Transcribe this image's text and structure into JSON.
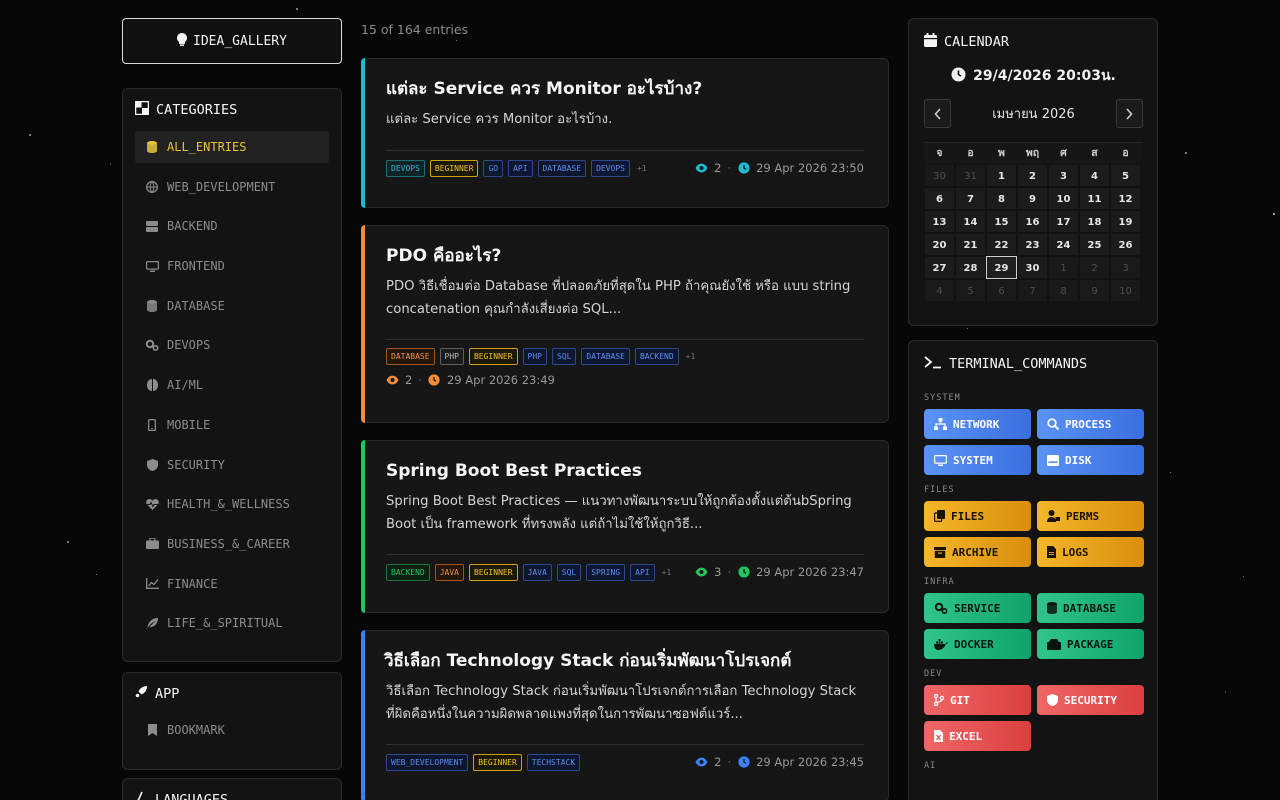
{
  "brand": {
    "label": "IDEA_GALLERY"
  },
  "categories": {
    "title": "CATEGORIES",
    "items": [
      {
        "label": "ALL_ENTRIES",
        "icon": "database-icon"
      },
      {
        "label": "WEB_DEVELOPMENT",
        "icon": "globe-icon"
      },
      {
        "label": "BACKEND",
        "icon": "server-icon"
      },
      {
        "label": "FRONTEND",
        "icon": "monitor-icon"
      },
      {
        "label": "DATABASE",
        "icon": "database-icon"
      },
      {
        "label": "DEVOPS",
        "icon": "gears-icon"
      },
      {
        "label": "AI/ML",
        "icon": "brain-icon"
      },
      {
        "label": "MOBILE",
        "icon": "mobile-icon"
      },
      {
        "label": "SECURITY",
        "icon": "shield-icon"
      },
      {
        "label": "HEALTH_&_WELLNESS",
        "icon": "heart-pulse-icon"
      },
      {
        "label": "BUSINESS_&_CAREER",
        "icon": "briefcase-icon"
      },
      {
        "label": "FINANCE",
        "icon": "chart-line-icon"
      },
      {
        "label": "LIFE_&_SPIRITUAL",
        "icon": "feather-icon"
      }
    ]
  },
  "app": {
    "title": "APP",
    "items": [
      {
        "label": "BOOKMARK"
      }
    ]
  },
  "languages": {
    "title": "LANGUAGES"
  },
  "feed": {
    "count_text": "15 of 164 entries",
    "cards": [
      {
        "title": "แต่ละ Service ควร Monitor อะไรบ้าง?",
        "excerpt": "แต่ละ Service ควร Monitor อะไรบ้าง.",
        "tags": [
          "DEVOPS",
          "BEGINNER",
          "GO",
          "API",
          "DATABASE",
          "DEVOPS"
        ],
        "more": "+1",
        "views": "2",
        "date": "29 Apr 2026 23:50",
        "accent": "#22b8cf"
      },
      {
        "title": "PDO คืออะไร?",
        "excerpt": "PDO วิธีเชื่อมต่อ Database ที่ปลอดภัยที่สุดใน PHP ถ้าคุณยังใช้ หรือ แบบ string concatenation คุณกำลังเสี่ยงต่อ SQL...",
        "tags": [
          "DATABASE",
          "PHP",
          "BEGINNER",
          "PHP",
          "SQL",
          "DATABASE",
          "BACKEND"
        ],
        "more": "+1",
        "views": "2",
        "date": "29 Apr 2026 23:49",
        "accent": "#f08c3a"
      },
      {
        "title": "Spring Boot Best Practices",
        "excerpt": "Spring Boot Best Practices — แนวทางพัฒนาระบบให้ถูกต้องตั้งแต่ต้นbSpring Boot เป็น framework ที่ทรงพลัง แต่ถ้าไม่ใช้ให้ถูกวิธี...",
        "tags": [
          "BACKEND",
          "JAVA",
          "BEGINNER",
          "JAVA",
          "SQL",
          "SPRING",
          "API"
        ],
        "more": "+1",
        "views": "3",
        "date": "29 Apr 2026 23:47",
        "accent": "#22c55e"
      },
      {
        "title": "วิธีเลือก Technology Stack ก่อนเริ่มพัฒนาโปรเจกต์",
        "excerpt": "วิธีเลือก Technology Stack ก่อนเริ่มพัฒนาโปรเจกต์การเลือก Technology Stack ที่ผิดคือหนึ่งในความผิดพลาดแพงที่สุดในการพัฒนาซอฟต์แวร์...",
        "tags": [
          "WEB_DEVELOPMENT",
          "BEGINNER",
          "TECHSTACK"
        ],
        "more": "",
        "views": "2",
        "date": "29 Apr 2026 23:45",
        "accent": "#3b82f6"
      }
    ]
  },
  "calendar": {
    "title": "CALENDAR",
    "now": "29/4/2026 20:03น.",
    "month_label": "เมษายน 2026",
    "weekdays": [
      "จ",
      "อ",
      "พ",
      "พฤ",
      "ศ",
      "ส",
      "อ"
    ],
    "days": [
      [
        "30",
        "31",
        "1",
        "2",
        "3",
        "4",
        "5"
      ],
      [
        "6",
        "7",
        "8",
        "9",
        "10",
        "11",
        "12"
      ],
      [
        "13",
        "14",
        "15",
        "16",
        "17",
        "18",
        "19"
      ],
      [
        "20",
        "21",
        "22",
        "23",
        "24",
        "25",
        "26"
      ],
      [
        "27",
        "28",
        "29",
        "30",
        "1",
        "2",
        "3"
      ],
      [
        "4",
        "5",
        "6",
        "7",
        "8",
        "9",
        "10"
      ]
    ],
    "today": "29"
  },
  "terminal": {
    "title": "TERMINAL_COMMANDS",
    "groups": [
      {
        "label": "SYSTEM",
        "color": "blue",
        "buttons": [
          {
            "label": "NETWORK",
            "icon": "network-icon"
          },
          {
            "label": "PROCESS",
            "icon": "search-icon"
          },
          {
            "label": "SYSTEM",
            "icon": "monitor-icon"
          },
          {
            "label": "DISK",
            "icon": "disk-icon"
          }
        ]
      },
      {
        "label": "FILES",
        "color": "amber",
        "buttons": [
          {
            "label": "FILES",
            "icon": "copy-icon"
          },
          {
            "label": "PERMS",
            "icon": "user-lock-icon"
          },
          {
            "label": "ARCHIVE",
            "icon": "archive-icon"
          },
          {
            "label": "LOGS",
            "icon": "file-icon"
          }
        ]
      },
      {
        "label": "INFRA",
        "color": "green",
        "buttons": [
          {
            "label": "SERVICE",
            "icon": "gears-icon"
          },
          {
            "label": "DATABASE",
            "icon": "database-icon"
          },
          {
            "label": "DOCKER",
            "icon": "docker-icon"
          },
          {
            "label": "PACKAGE",
            "icon": "package-icon"
          }
        ]
      },
      {
        "label": "DEV",
        "color": "red",
        "buttons": [
          {
            "label": "GIT",
            "icon": "git-icon"
          },
          {
            "label": "SECURITY",
            "icon": "shield-icon"
          },
          {
            "label": "EXCEL",
            "icon": "file-excel-icon"
          }
        ]
      },
      {
        "label": "AI",
        "color": "blue",
        "buttons": []
      }
    ]
  }
}
